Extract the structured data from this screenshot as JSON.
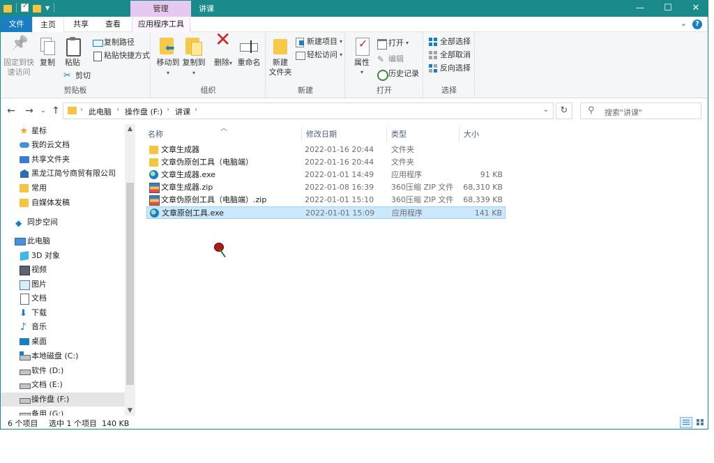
{
  "titlebar": {
    "context_tab": "管理",
    "title": "讲课",
    "minimize": "—",
    "maximize": "☐",
    "close": "✕"
  },
  "tabs": {
    "file": "文件",
    "home": "主页",
    "share": "共享",
    "view": "查看",
    "app_tools": "应用程序工具"
  },
  "ribbon": {
    "clipboard": {
      "label": "剪贴板",
      "pin_line1": "固定到快",
      "pin_line2": "速访问",
      "copy": "复制",
      "paste": "粘贴",
      "copy_path": "复制路径",
      "paste_shortcut": "粘贴快捷方式",
      "cut": "剪切"
    },
    "organize": {
      "label": "组织",
      "move_to": "移动到",
      "copy_to": "复制到",
      "delete": "删除",
      "rename": "重命名"
    },
    "new": {
      "label": "新建",
      "new_folder_line1": "新建",
      "new_folder_line2": "文件夹",
      "new_item": "新建项目",
      "easy_access": "轻松访问"
    },
    "open": {
      "label": "打开",
      "properties": "属性",
      "open": "打开",
      "edit": "编辑",
      "history": "历史记录"
    },
    "select": {
      "label": "选择",
      "select_all": "全部选择",
      "select_none": "全部取消",
      "invert": "反向选择"
    }
  },
  "address": {
    "crumbs": [
      "此电脑",
      "操作盘 (F:)",
      "讲课"
    ],
    "search_placeholder": "搜索\"讲课\""
  },
  "nav": [
    {
      "label": "星标",
      "icon": "star-icon"
    },
    {
      "label": "我的云文档",
      "icon": "cloud-icon"
    },
    {
      "label": "共享文件夹",
      "icon": "shared-folder-icon"
    },
    {
      "label": "黑龙江简兮商贸有限公司",
      "icon": "company-icon"
    },
    {
      "label": "常用",
      "icon": "folder-icon"
    },
    {
      "label": "自媒体发稿",
      "icon": "folder-icon"
    },
    {
      "label": "同步空间",
      "icon": "sync-icon"
    },
    {
      "label": "此电脑",
      "icon": "computer-icon"
    },
    {
      "label": "3D 对象",
      "icon": "3d-objects-icon"
    },
    {
      "label": "视频",
      "icon": "video-icon"
    },
    {
      "label": "图片",
      "icon": "pictures-icon"
    },
    {
      "label": "文档",
      "icon": "documents-icon"
    },
    {
      "label": "下载",
      "icon": "download-icon"
    },
    {
      "label": "音乐",
      "icon": "music-icon"
    },
    {
      "label": "桌面",
      "icon": "desktop-icon"
    },
    {
      "label": "本地磁盘 (C:)",
      "icon": "drive-c-icon"
    },
    {
      "label": "软件 (D:)",
      "icon": "drive-icon"
    },
    {
      "label": "文档 (E:)",
      "icon": "drive-icon"
    },
    {
      "label": "操作盘 (F:)",
      "icon": "drive-icon"
    },
    {
      "label": "备用 (G:)",
      "icon": "drive-icon"
    }
  ],
  "columns": {
    "name": "名称",
    "date": "修改日期",
    "type": "类型",
    "size": "大小"
  },
  "files": [
    {
      "name": "文章生成器",
      "date": "2022-01-16 20:44",
      "type": "文件夹",
      "size": "",
      "icon": "folder-icon"
    },
    {
      "name": "文章伪原创工具（电脑端）",
      "date": "2022-01-16 20:44",
      "type": "文件夹",
      "size": "",
      "icon": "folder-icon"
    },
    {
      "name": "文章生成器.exe",
      "date": "2022-01-01 14:49",
      "type": "应用程序",
      "size": "91 KB",
      "icon": "exe-icon"
    },
    {
      "name": "文章生成器.zip",
      "date": "2022-01-08 16:39",
      "type": "360压缩 ZIP 文件",
      "size": "68,310 KB",
      "icon": "zip-icon"
    },
    {
      "name": "文章伪原创工具（电脑端）.zip",
      "date": "2022-01-01 15:10",
      "type": "360压缩 ZIP 文件",
      "size": "68,339 KB",
      "icon": "zip-icon"
    },
    {
      "name": "文章原创工具.exe",
      "date": "2022-01-01 15:09",
      "type": "应用程序",
      "size": "141 KB",
      "icon": "exe-icon"
    }
  ],
  "status": {
    "count": "6 个项目",
    "selected": "选中 1 个项目  140 KB"
  },
  "colors": {
    "titlebar": "#1a8a8a",
    "file_tab": "#1a7ec4",
    "manage_tab": "#e6c9f0",
    "selection": "#cce8ff"
  }
}
